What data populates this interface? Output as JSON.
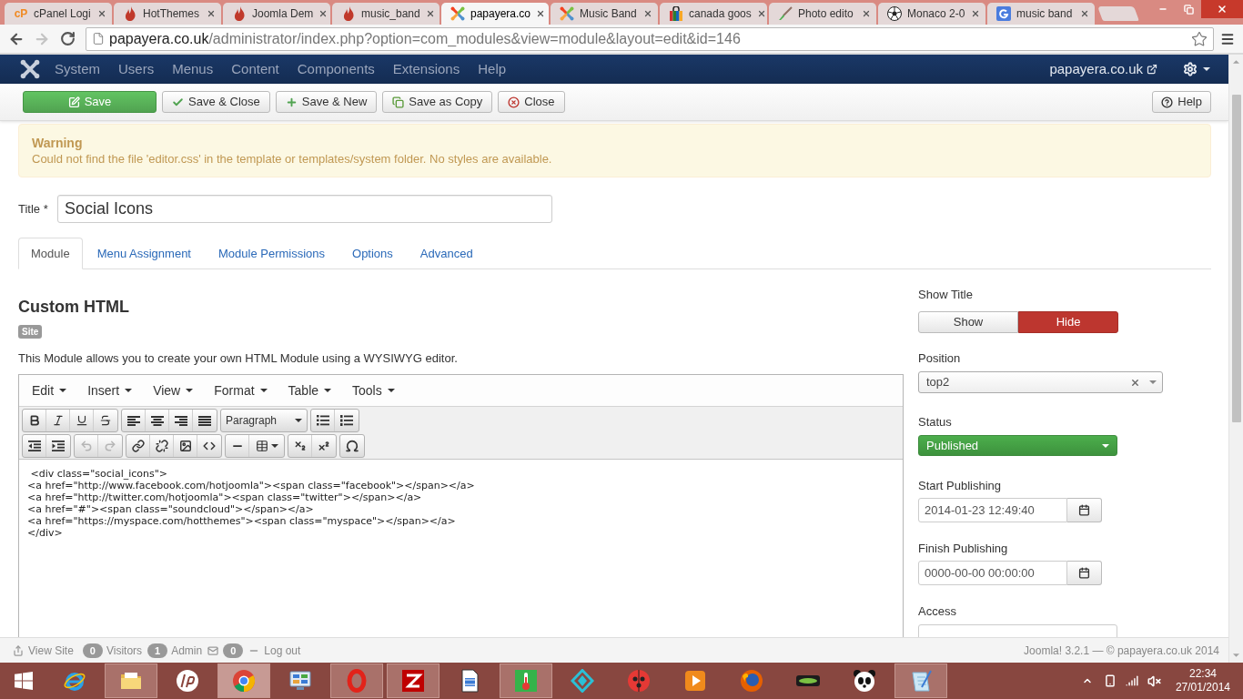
{
  "browser": {
    "tabs": [
      {
        "title": "cPanel Logi",
        "kind": "letters",
        "icon_text": "cP",
        "selected": false
      },
      {
        "title": "HotThemes",
        "kind": "flame",
        "selected": false
      },
      {
        "title": "Joomla Dem",
        "kind": "flame",
        "selected": false
      },
      {
        "title": "music_band",
        "kind": "flame",
        "selected": false
      },
      {
        "title": "papayera.co",
        "kind": "arms",
        "selected": true
      },
      {
        "title": "Music Band",
        "kind": "arms",
        "selected": false
      },
      {
        "title": "canada goos",
        "kind": "bag",
        "selected": false
      },
      {
        "title": "Photo edito",
        "kind": "brush",
        "selected": false
      },
      {
        "title": "Monaco 2-0",
        "kind": "ball",
        "selected": false
      },
      {
        "title": "music band",
        "kind": "square",
        "selected": false
      }
    ],
    "forward_disabled": true,
    "address": {
      "host": "papayera.co.uk",
      "path": "/administrator/index.php?option=com_modules&view=module&layout=edit&id=146"
    }
  },
  "navbar": {
    "menu": [
      "System",
      "Users",
      "Menus",
      "Content",
      "Components",
      "Extensions",
      "Help"
    ],
    "site_link": "papayera.co.uk"
  },
  "toolbar": {
    "buttons": [
      {
        "label": "Save",
        "kind": "primary"
      },
      {
        "label": "Save & Close",
        "kind": "default"
      },
      {
        "label": "Save & New",
        "kind": "default"
      },
      {
        "label": "Save as Copy",
        "kind": "default"
      },
      {
        "label": "Close",
        "kind": "default"
      }
    ],
    "help": "Help"
  },
  "warning": {
    "title": "Warning",
    "message": "Could not find the file 'editor.css' in the template or templates/system folder. No styles are available."
  },
  "title_field": {
    "label": "Title *",
    "value": "Social Icons"
  },
  "tabs": [
    {
      "label": "Module",
      "selected": true
    },
    {
      "label": "Menu Assignment",
      "selected": false
    },
    {
      "label": "Module Permissions",
      "selected": false
    },
    {
      "label": "Options",
      "selected": false
    },
    {
      "label": "Advanced",
      "selected": false
    }
  ],
  "module": {
    "heading": "Custom HTML",
    "badge": "Site",
    "description": "This Module allows you to create your own HTML Module using a WYSIWYG editor."
  },
  "editor": {
    "menus": [
      "Edit",
      "Insert",
      "View",
      "Format",
      "Table",
      "Tools"
    ],
    "format_select": "Paragraph",
    "undo_disabled": true,
    "redo_disabled": true,
    "content": [
      " <div class=\"social_icons\">",
      "<a href=\"http://www.facebook.com/hotjoomla\"><span class=\"facebook\"></span></a>",
      "<a href=\"http://twitter.com/hotjoomla\"><span class=\"twitter\"></span></a>",
      "<a href=\"#\"><span class=\"soundcloud\"></span></a>",
      "<a href=\"https://myspace.com/hotthemes\"><span class=\"myspace\"></span></a>",
      "</div>"
    ]
  },
  "sidebar": {
    "show_title": {
      "label": "Show Title",
      "options": [
        {
          "label": "Show",
          "selected": false
        },
        {
          "label": "Hide",
          "selected": true
        }
      ]
    },
    "position": {
      "label": "Position",
      "value": "top2"
    },
    "status": {
      "label": "Status",
      "value": "Published"
    },
    "start_publishing": {
      "label": "Start Publishing",
      "value": "2014-01-23 12:49:40"
    },
    "finish_publishing": {
      "label": "Finish Publishing",
      "value": "0000-00-00 00:00:00"
    },
    "access": {
      "label": "Access"
    }
  },
  "status_bar": {
    "view_site": "View Site",
    "visitors": {
      "count": "0",
      "label": "Visitors"
    },
    "admins": {
      "count": "1",
      "label": "Admin"
    },
    "messages": {
      "count": "0"
    },
    "logout": "Log out",
    "footer": "Joomla! 3.2.1 — © papayera.co.uk 2014"
  },
  "taskbar": {
    "apps": [
      {
        "kind": "ring",
        "running": false,
        "selected": false
      },
      {
        "kind": "folder",
        "running": true,
        "selected": false
      },
      {
        "kind": "round",
        "running": false,
        "selected": false
      },
      {
        "kind": "wheel",
        "running": true,
        "selected": true
      },
      {
        "kind": "panel",
        "running": false,
        "selected": false
      },
      {
        "kind": "oval",
        "running": true,
        "selected": false
      },
      {
        "kind": "tile",
        "running": true,
        "selected": false
      },
      {
        "kind": "document",
        "running": false,
        "selected": false
      },
      {
        "kind": "thermometer",
        "running": true,
        "selected": false
      },
      {
        "kind": "diamond",
        "running": false,
        "selected": false
      },
      {
        "kind": "ladybug",
        "running": false,
        "selected": false
      },
      {
        "kind": "play",
        "running": false,
        "selected": false
      },
      {
        "kind": "fox",
        "running": false,
        "selected": false
      },
      {
        "kind": "pill",
        "running": false,
        "selected": false
      },
      {
        "kind": "panda",
        "running": false,
        "selected": false
      },
      {
        "kind": "notepad",
        "running": true,
        "selected": false
      }
    ],
    "time": "22:34",
    "date": "27/01/2014"
  }
}
